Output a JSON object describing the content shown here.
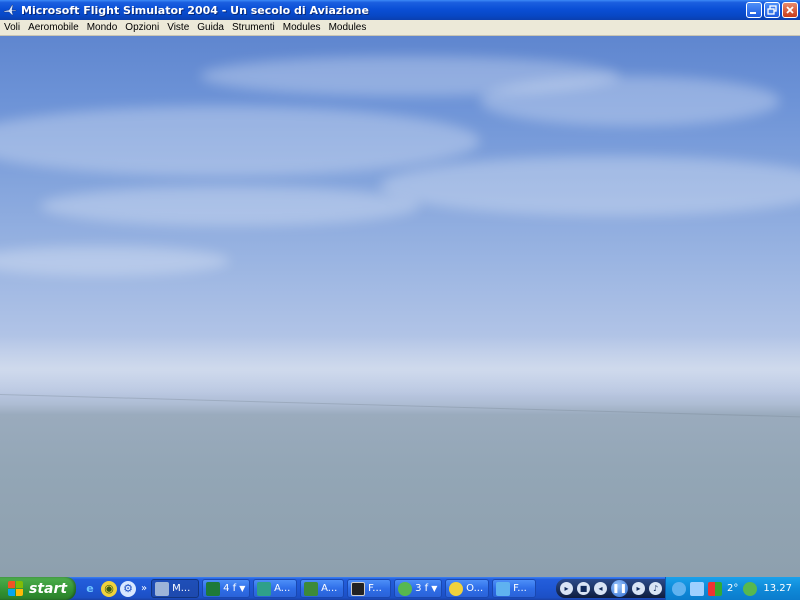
{
  "window": {
    "title": "Microsoft Flight Simulator 2004 - Un secolo di Aviazione",
    "icon": "plane-icon",
    "caption_buttons": [
      "minimize-icon",
      "restore-icon",
      "close-icon"
    ]
  },
  "menubar": {
    "items": [
      "Voli",
      "Aeromobile",
      "Mondo",
      "Opzioni",
      "Viste",
      "Guida",
      "Strumenti",
      "Modules",
      "Modules"
    ]
  },
  "taskbar": {
    "start_label": "start",
    "quick_launch": [
      "ie-icon",
      "media-icon",
      "settings-icon"
    ],
    "tasks": [
      {
        "label": "M...",
        "icon": "plane-icon",
        "active": true
      },
      {
        "label": "4 f",
        "icon": "excel-icon",
        "group": true
      },
      {
        "label": "A...",
        "icon": "app-icon"
      },
      {
        "label": "A...",
        "icon": "game-icon"
      },
      {
        "label": "F...",
        "icon": "window-icon"
      },
      {
        "label": "3 f",
        "icon": "messenger-icon",
        "group": true
      },
      {
        "label": "O...",
        "icon": "media-icon"
      },
      {
        "label": "F...",
        "icon": "ie-icon"
      }
    ],
    "tray": {
      "temperature": "2°",
      "clock": "13.27"
    }
  },
  "colors": {
    "titlebar": "#0a4fd6",
    "taskbar": "#245edb",
    "start": "#3c9c3c",
    "menubar": "#ece9d8"
  }
}
